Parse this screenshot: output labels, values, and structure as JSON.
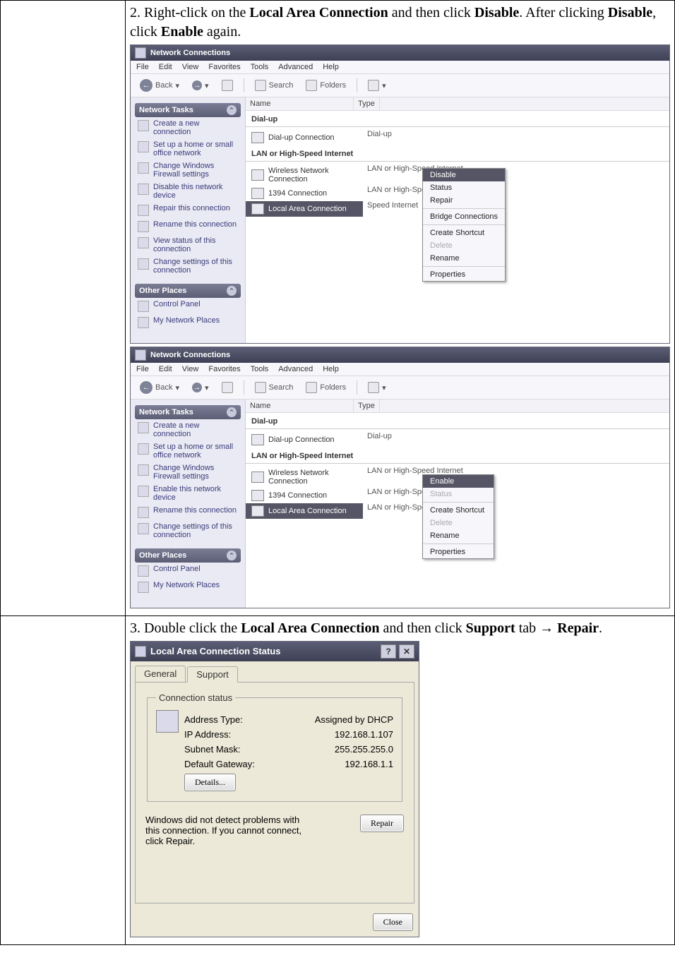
{
  "row2": {
    "instruction_prefix": "2. Right-click on the ",
    "lac_bold": "Local Area Connection",
    "mid1": " and then click ",
    "disable_bold": "Disable",
    "mid2": ". After clicking ",
    "mid3": ", click ",
    "enable_bold": "Enable",
    "suffix": " again."
  },
  "row3": {
    "p1": "3. Double click the ",
    "b1": "Local Area Connection",
    "p2": " and then click ",
    "b2": "Support",
    "p3": " tab → ",
    "b3": "Repair",
    "p4": "."
  },
  "explorer": {
    "title": "Network Connections",
    "menu": [
      "File",
      "Edit",
      "View",
      "Favorites",
      "Tools",
      "Advanced",
      "Help"
    ],
    "toolbar": {
      "back": "Back",
      "search": "Search",
      "folders": "Folders"
    },
    "cols": {
      "name": "Name",
      "type": "Type"
    },
    "group_dialup": "Dial-up",
    "group_lan": "LAN or High-Speed Internet",
    "dialup_conn": {
      "name": "Dial-up Connection",
      "type": "Dial-up"
    },
    "lan_conns": [
      {
        "name": "Wireless Network Connection",
        "type": "LAN or High-Speed Internet"
      },
      {
        "name": "1394 Connection",
        "type": "LAN or High-Speed Internet"
      },
      {
        "name": "Local Area Connection",
        "type": "LAN or High-Speed Internet",
        "type_short": "Speed Internet",
        "type_short2": "LAN or High-Speed Internet"
      }
    ],
    "ntasks_title": "Network Tasks",
    "other_title": "Other Places",
    "tasks_disable": [
      "Create a new connection",
      "Set up a home or small office network",
      "Change Windows Firewall settings",
      "Disable this network device",
      "Repair this connection",
      "Rename this connection",
      "View status of this connection",
      "Change settings of this connection"
    ],
    "tasks_enable": [
      "Create a new connection",
      "Set up a home or small office network",
      "Change Windows Firewall settings",
      "Enable this network device",
      "Rename this connection",
      "Change settings of this connection"
    ],
    "other_places": [
      "Control Panel",
      "My Network Places"
    ],
    "ctx_disable": {
      "sel": "Disable",
      "items": [
        "Status",
        "Repair"
      ],
      "items2": [
        "Bridge Connections"
      ],
      "items3": [
        "Create Shortcut",
        "Delete",
        "Rename"
      ],
      "items4": [
        "Properties"
      ]
    },
    "ctx_enable": {
      "sel": "Enable",
      "items": [
        "Status"
      ],
      "items2": [
        "Create Shortcut",
        "Delete",
        "Rename"
      ],
      "items3": [
        "Properties"
      ]
    }
  },
  "dlg": {
    "title": "Local Area Connection Status",
    "tabs": {
      "general": "General",
      "support": "Support"
    },
    "fieldset": "Connection status",
    "rows": [
      {
        "k": "Address Type:",
        "v": "Assigned by DHCP"
      },
      {
        "k": "IP Address:",
        "v": "192.168.1.107"
      },
      {
        "k": "Subnet Mask:",
        "v": "255.255.255.0"
      },
      {
        "k": "Default Gateway:",
        "v": "192.168.1.1"
      }
    ],
    "details": "Details...",
    "repair_text": "Windows did not detect problems with this connection. If you cannot connect, click Repair.",
    "repair_btn": "Repair",
    "close": "Close"
  }
}
